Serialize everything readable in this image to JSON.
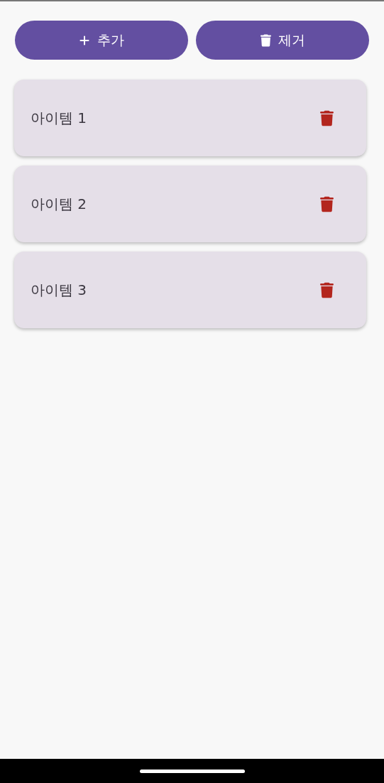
{
  "buttons": [
    {
      "kind": "add",
      "label": "추가"
    },
    {
      "kind": "remove",
      "label": "제거"
    }
  ],
  "items": [
    {
      "label": "아이템 1"
    },
    {
      "label": "아이템 2"
    },
    {
      "label": "아이템 3"
    }
  ]
}
